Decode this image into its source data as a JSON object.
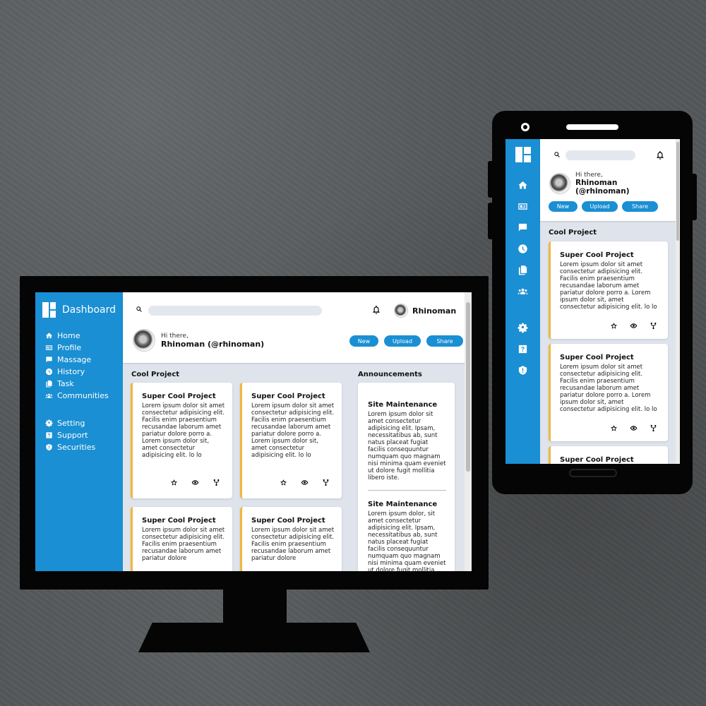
{
  "desktop": {
    "brand": "Dashboard",
    "nav": [
      {
        "label": "Home",
        "icon": "home-icon"
      },
      {
        "label": "Profile",
        "icon": "profile-card-icon"
      },
      {
        "label": "Massage",
        "icon": "message-icon"
      },
      {
        "label": "History",
        "icon": "clock-icon"
      },
      {
        "label": "Task",
        "icon": "document-icon"
      },
      {
        "label": "Communities",
        "icon": "people-icon"
      }
    ],
    "nav_bottom": [
      {
        "label": "Setting",
        "icon": "gear-icon"
      },
      {
        "label": "Support",
        "icon": "help-icon"
      },
      {
        "label": "Securities",
        "icon": "shield-icon"
      }
    ],
    "user_name": "Rhinoman",
    "greeting_small": "Hi there,",
    "greeting_name": "Rhinoman (@rhinoman)",
    "actions": [
      "New",
      "Upload",
      "Share"
    ],
    "section_projects": "Cool Project",
    "section_announcements": "Announcements",
    "cards": [
      {
        "title": "Super Cool Project",
        "body": "Lorem ipsum dolor sit amet consectetur adipisicing elit. Facilis enim praesentium recusandae laborum amet pariatur dolore porro a. Lorem ipsum dolor sit, amet consectetur adipisicing elit. lo lo"
      },
      {
        "title": "Super Cool Project",
        "body": "Lorem ipsum dolor sit amet consectetur adipisicing elit. Facilis enim praesentium recusandae laborum amet pariatur dolore porro a. Lorem ipsum dolor sit, amet consectetur adipisicing elit. lo lo"
      },
      {
        "title": "Super Cool Project",
        "body": "Lorem ipsum dolor sit amet consectetur adipisicing elit. Facilis enim praesentium recusandae laborum amet pariatur dolore"
      },
      {
        "title": "Super Cool Project",
        "body": "Lorem ipsum dolor sit amet consectetur adipisicing elit. Facilis enim praesentium recusandae laborum amet pariatur dolore"
      }
    ],
    "announcements": [
      {
        "title": "Site Maintenance",
        "body": "Lorem ipsum dolor sit amet consectetur adipisicing elit. Ipsam, necessitatibus ab, sunt natus placeat fugiat facilis consequuntur numquam quo magnam nisi minima quam eveniet ut dolore fugit mollitia libero iste."
      },
      {
        "title": "Site Maintenance",
        "body": "Lorem ipsum dolor, sit amet consectetur adipisicing elit. Ipsam, necessitatibus ab, sunt natus placeat fugiat facilis consequuntur numquam quo magnam nisi minima quam eveniet ut dolore fugit mollitia libero iste."
      }
    ]
  },
  "mobile": {
    "greeting_small": "Hi there,",
    "greeting_name_line1": "Rhinoman",
    "greeting_name_line2": "(@rhinoman)",
    "actions": [
      "New",
      "Upload",
      "Share"
    ],
    "section_projects": "Cool Project",
    "nav_icons": [
      "home-icon",
      "profile-card-icon",
      "message-icon",
      "clock-icon",
      "document-icon",
      "people-icon",
      "gear-icon",
      "help-icon",
      "shield-icon"
    ],
    "cards": [
      {
        "title": "Super Cool Project",
        "body": "Lorem ipsum dolor sit amet consectetur adipisicing elit. Facilis enim praesentium recusandae laborum amet pariatur dolore porro a. Lorem ipsum dolor sit, amet consectetur adipisicing elit. lo lo"
      },
      {
        "title": "Super Cool Project",
        "body": "Lorem ipsum dolor sit amet consectetur adipisicing elit. Facilis enim praesentium recusandae laborum amet pariatur dolore porro a. Lorem ipsum dolor sit, amet consectetur adipisicing elit. lo lo"
      },
      {
        "title": "Super Cool Project",
        "body": ""
      }
    ]
  },
  "colors": {
    "accent": "#1a8fd3",
    "card_border": "#f0b73d",
    "content_bg": "#dfe4ec"
  }
}
